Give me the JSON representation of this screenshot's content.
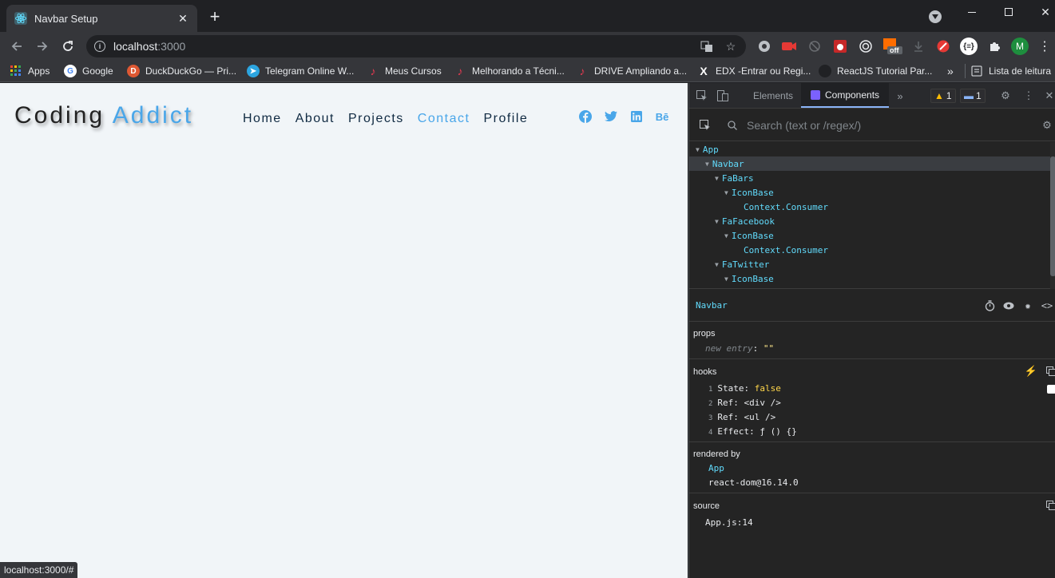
{
  "browser": {
    "tab_title": "Navbar Setup",
    "url_host": "localhost",
    "url_port": ":3000",
    "status_url": "localhost:3000/#",
    "bookmarks": [
      {
        "label": "Apps"
      },
      {
        "label": "Google"
      },
      {
        "label": "DuckDuckGo — Pri..."
      },
      {
        "label": "Telegram Online W..."
      },
      {
        "label": "Meus Cursos"
      },
      {
        "label": "Melhorando a Técni..."
      },
      {
        "label": "DRIVE Ampliando a..."
      },
      {
        "label": "EDX -Entrar ou Regi..."
      },
      {
        "label": "ReactJS Tutorial Par..."
      },
      {
        "label": "Lista de leitura"
      }
    ],
    "more_bookmarks": "»",
    "profile_initial": "M",
    "ext_badge": "off"
  },
  "page": {
    "logo_main": "Coding ",
    "logo_accent": "Addict",
    "nav_links": [
      "Home",
      "About",
      "Projects",
      "Contact",
      "Profile"
    ],
    "social_behance": "Bē"
  },
  "devtools": {
    "tabs": [
      "Elements",
      "Components"
    ],
    "warnings": "1",
    "messages": "1",
    "search_placeholder": "Search (text or /regex/)",
    "tree": [
      {
        "name": "App",
        "depth": 0
      },
      {
        "name": "Navbar",
        "depth": 1
      },
      {
        "name": "FaBars",
        "depth": 2
      },
      {
        "name": "IconBase",
        "depth": 3
      },
      {
        "name": "Context.Consumer",
        "depth": 4
      },
      {
        "name": "FaFacebook",
        "depth": 2
      },
      {
        "name": "IconBase",
        "depth": 3
      },
      {
        "name": "Context.Consumer",
        "depth": 4
      },
      {
        "name": "FaTwitter",
        "depth": 2
      },
      {
        "name": "IconBase",
        "depth": 3
      }
    ],
    "selected": "Navbar",
    "props_title": "props",
    "props_new_entry": "new entry",
    "props_value": "\"\"",
    "hooks_title": "hooks",
    "hooks": [
      {
        "idx": "1",
        "label": "State:",
        "value": "false"
      },
      {
        "idx": "2",
        "label": "Ref:",
        "value": "<div />"
      },
      {
        "idx": "3",
        "label": "Ref:",
        "value": "<ul />"
      },
      {
        "idx": "4",
        "label": "Effect:",
        "value": "ƒ () {}"
      }
    ],
    "rendered_by_title": "rendered by",
    "rendered_by": [
      "App",
      "react-dom@16.14.0"
    ],
    "source_title": "source",
    "source_value": "App.js:14"
  }
}
